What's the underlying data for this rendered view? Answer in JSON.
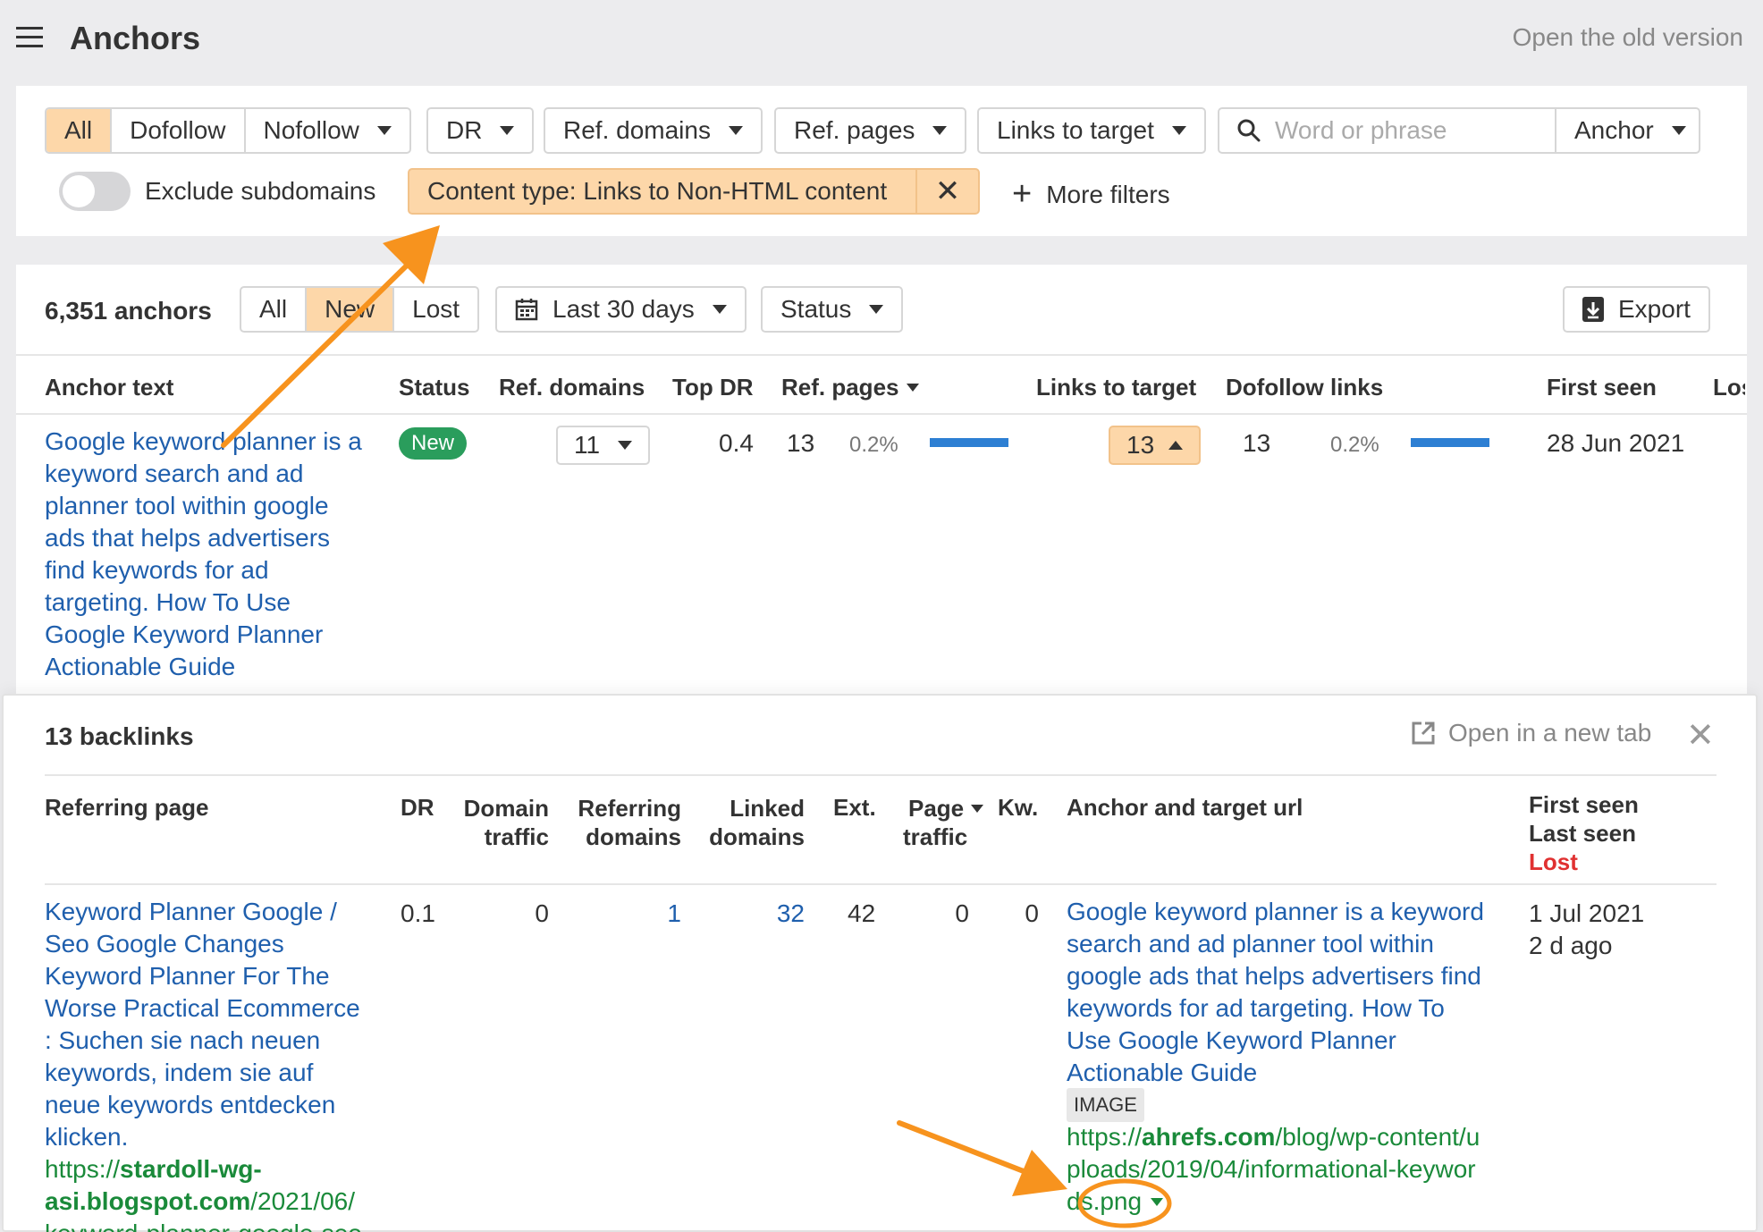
{
  "header": {
    "title": "Anchors",
    "old_version_link": "Open the old version"
  },
  "filters": {
    "link_type_tabs": [
      "All",
      "Dofollow",
      "Nofollow"
    ],
    "dr": "DR",
    "ref_domains": "Ref. domains",
    "ref_pages": "Ref. pages",
    "links_to_target": "Links to target",
    "search_placeholder": "Word or phrase",
    "search_mode": "Anchor",
    "exclude_subdomains": "Exclude subdomains",
    "content_type_chip": "Content type: Links to Non-HTML content",
    "more_filters": "More filters"
  },
  "results": {
    "count": "6,351 anchors",
    "tabs": [
      "All",
      "New",
      "Lost"
    ],
    "date_range": "Last 30 days",
    "status": "Status",
    "export": "Export"
  },
  "table": {
    "headers": [
      "Anchor text",
      "Status",
      "Ref. domains",
      "Top DR",
      "Ref. pages",
      "Links to target",
      "Dofollow links",
      "First seen",
      "Lost"
    ],
    "row": {
      "anchor_lines": [
        "Google keyword planner is a",
        "keyword search and ad",
        "planner tool within google",
        "ads that helps advertisers",
        "find keywords for ad",
        "targeting. How To Use",
        "Google Keyword Planner",
        "Actionable Guide"
      ],
      "status": "New",
      "ref_domains": "11",
      "top_dr": "0.4",
      "ref_pages": "13",
      "ref_pages_pct": "0.2%",
      "ref_pages_bar": 1.0,
      "links_to_target": "13",
      "dofollow": "13",
      "dofollow_pct": "0.2%",
      "dofollow_bar": 1.0,
      "first_seen": "28 Jun 2021"
    }
  },
  "backlinks": {
    "title": "13 backlinks",
    "open_new_tab": "Open in a new tab",
    "headers": {
      "referring_page": "Referring page",
      "dr": "DR",
      "domain_traffic": [
        "Domain",
        "traffic"
      ],
      "referring_domains": [
        "Referring",
        "domains"
      ],
      "linked_domains": [
        "Linked",
        "domains"
      ],
      "ext": "Ext.",
      "page_traffic": [
        "Page",
        "traffic"
      ],
      "kw": "Kw.",
      "anchor_target": "Anchor and target url",
      "first_seen": "First seen",
      "last_seen": "Last seen",
      "lost": "Lost"
    },
    "row": {
      "page_title_lines": [
        "Keyword Planner Google /",
        "Seo Google Changes",
        "Keyword Planner For The",
        "Worse Practical Ecommerce",
        ": Suchen sie nach neuen",
        "keywords, indem sie auf",
        "neue keywords entdecken",
        "klicken."
      ],
      "url_prefix": "https://",
      "url_domain_1": "stardoll-wg-",
      "url_domain_2": "asi.blogspot.com",
      "url_path_1": "/2021/06/",
      "url_path_2": "keyword-planner-google-seo",
      "dr": "0.1",
      "domain_traffic": "0",
      "referring_domains": "1",
      "linked_domains": "32",
      "ext": "42",
      "page_traffic": "0",
      "kw": "0",
      "anchor_lines": [
        "Google keyword planner is a keyword",
        "search and ad planner tool within",
        "google ads that helps advertisers find",
        "keywords for ad targeting. How To",
        "Use Google Keyword Planner",
        "Actionable Guide"
      ],
      "badge": "IMAGE",
      "target_prefix": "https://",
      "target_domain": "ahrefs.com",
      "target_path_1": "/blog/wp-content/u",
      "target_path_2": "ploads/2019/04/informational-keywor",
      "target_path_3a": "d",
      "target_path_3b": "s.png",
      "first_seen": "1 Jul 2021",
      "last_seen": "2 d ago"
    }
  },
  "colors": {
    "accent": "#f7931e",
    "active_tab": "#fdd7a9",
    "link": "#1f5fad",
    "new_badge": "#2a9d5c",
    "bar": "#2d7fd3",
    "lost": "#e03131",
    "url_green": "#1a8a3a"
  }
}
